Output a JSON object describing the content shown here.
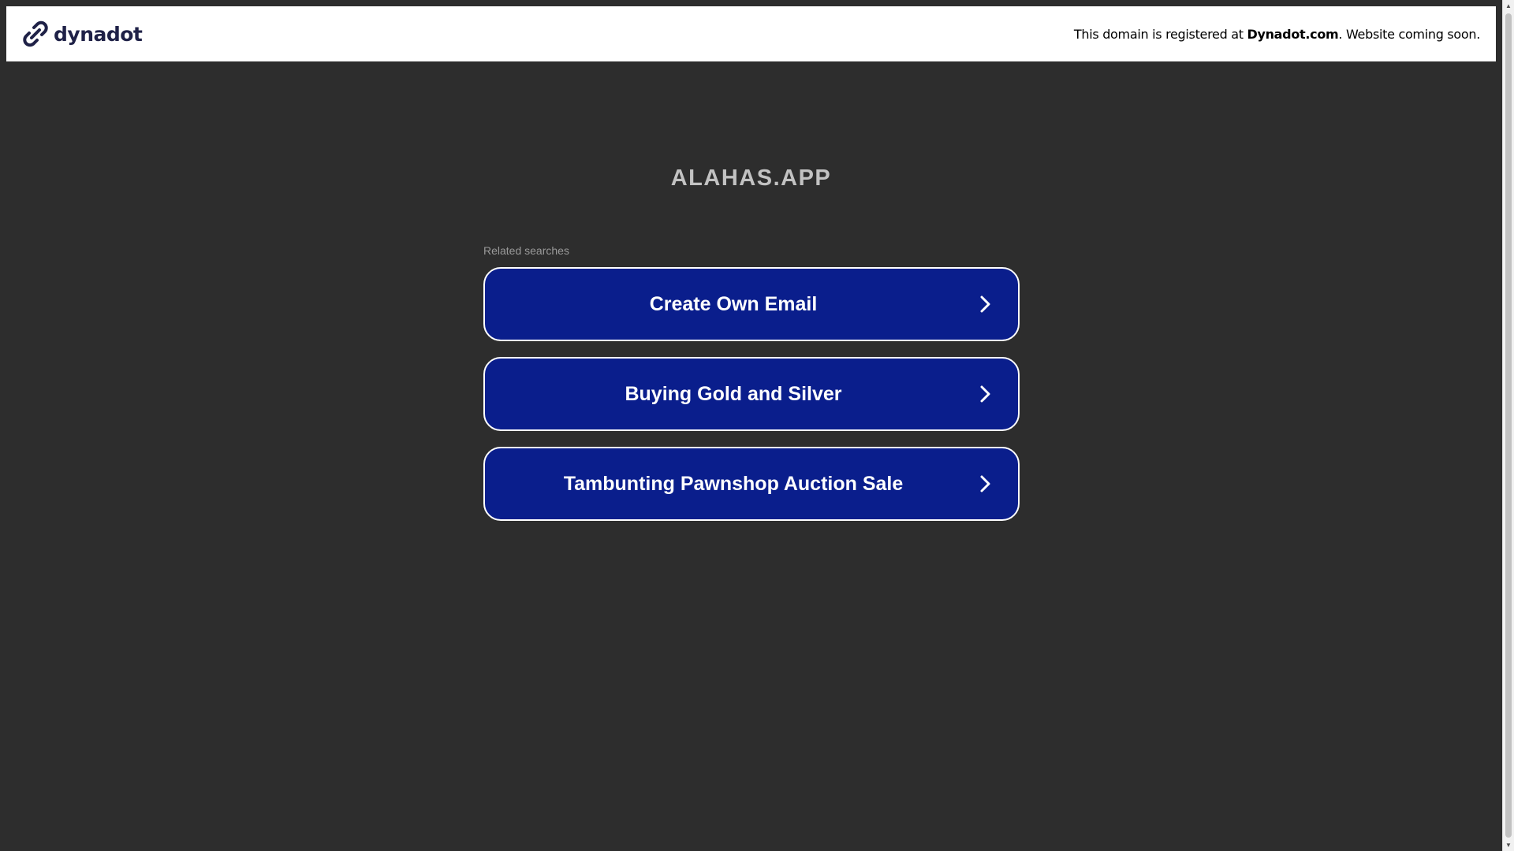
{
  "banner": {
    "brand_name": "dynadot",
    "message_prefix": "This domain is registered at ",
    "message_brand": "Dynadot.com",
    "message_suffix": ". Website coming soon."
  },
  "page": {
    "domain": "ALAHAS.APP",
    "related_label": "Related searches"
  },
  "related_searches": [
    {
      "label": "Create Own Email"
    },
    {
      "label": "Buying Gold and Silver"
    },
    {
      "label": "Tambunting Pawnshop Auction Sale"
    }
  ],
  "colors": {
    "background": "#2d2d2d",
    "button_bg": "#0a1e8c",
    "button_border": "#ffffff",
    "title": "#c2c2c2",
    "brand": "#1f2147"
  },
  "icons": {
    "brand": "dynadot-logo-icon",
    "chevron": "chevron-right-icon",
    "scroll_up": "scroll-up-arrow-icon",
    "scroll_down": "scroll-down-arrow-icon"
  }
}
